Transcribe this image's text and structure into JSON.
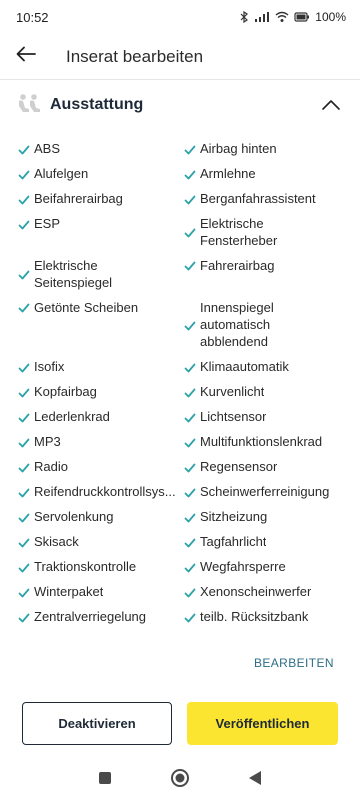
{
  "status_bar": {
    "time": "10:52",
    "battery": "100%"
  },
  "app_bar": {
    "title": "Inserat bearbeiten"
  },
  "section": {
    "title": "Ausstattung"
  },
  "features": [
    {
      "left": "ABS",
      "right": "Airbag hinten"
    },
    {
      "left": "Alufelgen",
      "right": "Armlehne"
    },
    {
      "left": "Beifahrerairbag",
      "right": "Berganfahrassistent"
    },
    {
      "left": "ESP",
      "right": "Elektrische Fensterheber"
    },
    {
      "left": "Elektrische Seitenspiegel",
      "right": "Fahrerairbag"
    },
    {
      "left": "Getönte Scheiben",
      "right": "Innenspiegel automatisch abblendend"
    },
    {
      "left": "Isofix",
      "right": "Klimaautomatik"
    },
    {
      "left": "Kopfairbag",
      "right": "Kurvenlicht"
    },
    {
      "left": "Lederlenkrad",
      "right": "Lichtsensor"
    },
    {
      "left": "MP3",
      "right": "Multifunktionslenkrad"
    },
    {
      "left": "Radio",
      "right": "Regensensor"
    },
    {
      "left": "Reifendruckkontrollsys...",
      "right": "Scheinwerferreinigung"
    },
    {
      "left": "Servolenkung",
      "right": "Sitzheizung"
    },
    {
      "left": "Skisack",
      "right": "Tagfahrlicht"
    },
    {
      "left": "Traktionskontrolle",
      "right": "Wegfahrsperre"
    },
    {
      "left": "Winterpaket",
      "right": "Xenonscheinwerfer"
    },
    {
      "left": "Zentralverriegelung",
      "right": "teilb. Rücksitzbank"
    }
  ],
  "edit_link": "BEARBEITEN",
  "buttons": {
    "deactivate": "Deaktivieren",
    "publish": "Veröffentlichen"
  },
  "colors": {
    "check": "#2aa3a8",
    "publish_bg": "#fbe531",
    "link": "#2d6e86"
  }
}
